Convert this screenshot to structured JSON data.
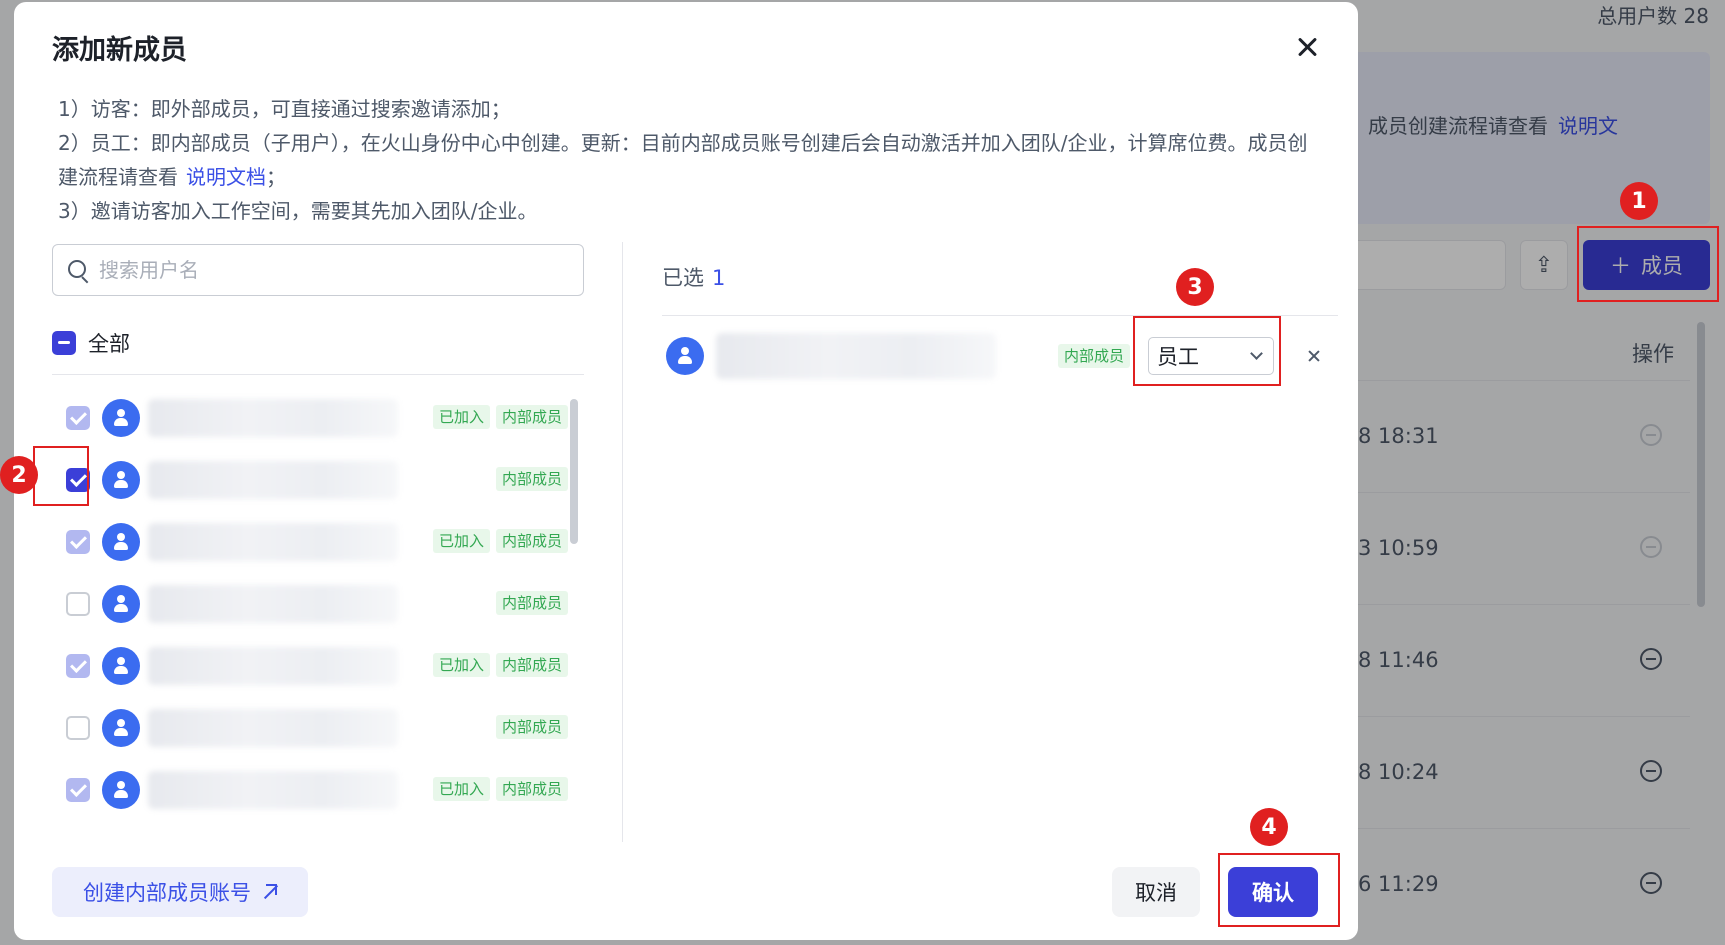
{
  "background": {
    "total_users": "总用户数 28",
    "banner_text": "成员创建流程请查看",
    "banner_link": "说明文",
    "add_member_label": "成员",
    "operations_header": "操作",
    "rows": [
      {
        "time": "8 18:31",
        "remove_disabled": true
      },
      {
        "time": "3 10:59",
        "remove_disabled": true
      },
      {
        "time": "8 11:46",
        "remove_disabled": false
      },
      {
        "time": "8 10:24",
        "remove_disabled": false
      },
      {
        "time": "6 11:29",
        "remove_disabled": false
      }
    ]
  },
  "modal": {
    "title": "添加新成员",
    "notes": {
      "line1": "1）访客：即外部成员，可直接通过搜索邀请添加；",
      "line2": "2）员工：即内部成员（子用户），在火山身份中心中创建。更新：目前内部成员账号创建后会自动激活并加入团队/企业，计算席位费。成员创建流程请查看",
      "line2_link": "说明文档",
      "line2_end": "；",
      "line3": "3）邀请访客加入工作空间，需要其先加入团队/企业。"
    },
    "search": {
      "placeholder": "搜索用户名",
      "value": ""
    },
    "select_all_label": "全部",
    "users": [
      {
        "state": "disabled-checked",
        "joined": "已加入",
        "type": "内部成员"
      },
      {
        "state": "checked",
        "joined": "",
        "type": "内部成员"
      },
      {
        "state": "disabled-checked",
        "joined": "已加入",
        "type": "内部成员"
      },
      {
        "state": "empty",
        "joined": "",
        "type": "内部成员"
      },
      {
        "state": "disabled-checked",
        "joined": "已加入",
        "type": "内部成员"
      },
      {
        "state": "empty",
        "joined": "",
        "type": "内部成员"
      },
      {
        "state": "disabled-checked",
        "joined": "已加入",
        "type": "内部成员"
      }
    ],
    "selected": {
      "label": "已选",
      "count": "1",
      "items": [
        {
          "type": "内部成员",
          "role": "员工"
        }
      ]
    },
    "footer": {
      "create_label": "创建内部成员账号",
      "cancel_label": "取消",
      "confirm_label": "确认"
    }
  },
  "steps": [
    "1",
    "2",
    "3",
    "4"
  ],
  "colors": {
    "accent": "#3b3fd8",
    "link": "#3b50e6",
    "tag_bg": "#e8f7ea",
    "tag_text": "#33a852",
    "annotation": "#e02020"
  }
}
